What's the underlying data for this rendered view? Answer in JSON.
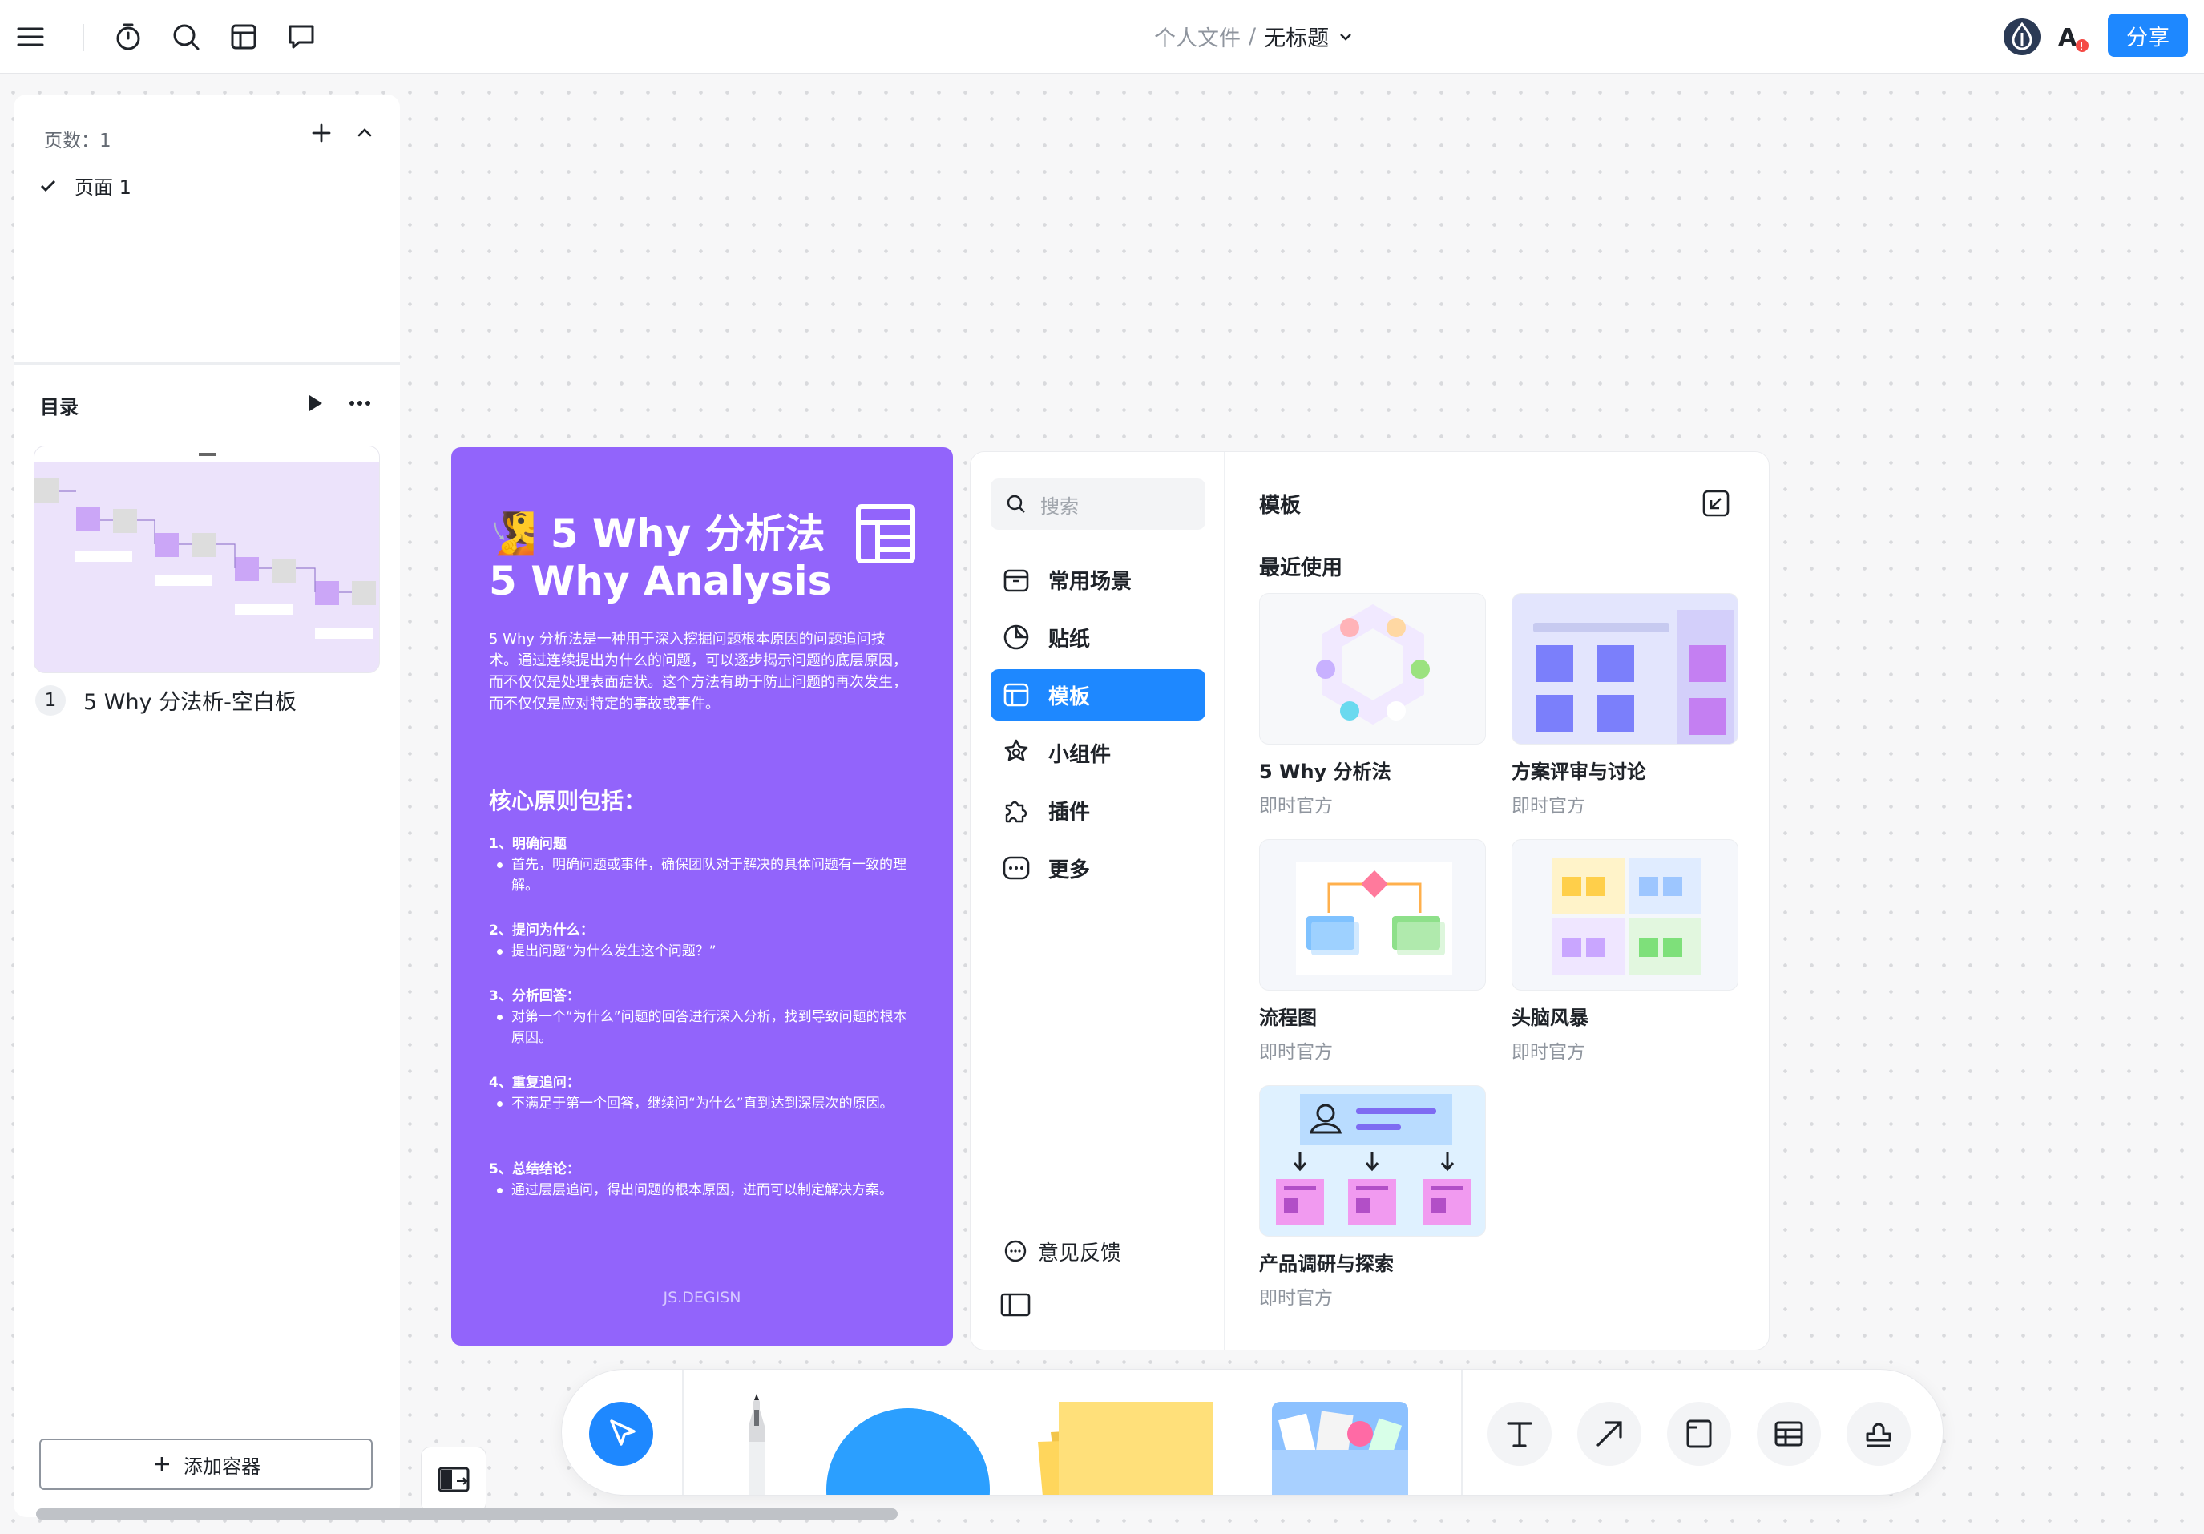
{
  "header": {
    "breadcrumb_root": "个人文件",
    "breadcrumb_sep": "/",
    "doc_title": "无标题",
    "share_label": "分享",
    "icons": [
      "menu-icon",
      "timer-icon",
      "search-icon",
      "template-icon",
      "comment-icon",
      "logo-icon",
      "font-ai-icon"
    ]
  },
  "left_panel": {
    "pages_label": "页数：1",
    "page_item": "页面 1",
    "toc_title": "目录",
    "thumb_number": "1",
    "thumb_name": "5 Why 分法析-空白板",
    "add_container": "添加容器"
  },
  "purple_card": {
    "emoji": "🧏",
    "title_cn": "5 Why 分析法",
    "title_en": "5 Why Analysis",
    "description": "5 Why 分析法是一种用于深入挖掘问题根本原因的问题追问技术。通过连续提出为什么的问题，可以逐步揭示问题的底层原因，而不仅仅是处理表面症状。这个方法有助于防止问题的再次发生，而不仅仅是应对特定的事故或事件。",
    "core_title": "核心原则包括：",
    "items": [
      {
        "h": "1、明确问题",
        "b": "首先，明确问题或事件，确保团队对于解决的具体问题有一致的理解。"
      },
      {
        "h": "2、提问为什么：",
        "b": "提出问题“为什么发生这个问题？”"
      },
      {
        "h": "3、分析回答：",
        "b": "对第一个“为什么”问题的回答进行深入分析，找到导致问题的根本原因。"
      },
      {
        "h": "4、重复追问：",
        "b": "不满足于第一个回答，继续问“为什么”直到达到深层次的原因。"
      },
      {
        "h": "5、总结结论：",
        "b": "通过层层追问，得出问题的根本原因，进而可以制定解决方案。"
      }
    ],
    "footer": "JS.DEGISN"
  },
  "template_panel": {
    "search_placeholder": "搜索",
    "nav": [
      {
        "label": "常用场景",
        "icon": "box-icon"
      },
      {
        "label": "贴纸",
        "icon": "sticker-icon"
      },
      {
        "label": "模板",
        "icon": "template-icon",
        "active": true
      },
      {
        "label": "小组件",
        "icon": "widget-icon"
      },
      {
        "label": "插件",
        "icon": "plugin-icon"
      },
      {
        "label": "更多",
        "icon": "more-icon"
      }
    ],
    "feedback": "意见反馈",
    "title": "模板",
    "recent_label": "最近使用",
    "cards": [
      {
        "name": "5 Why 分析法",
        "sub": "即时官方"
      },
      {
        "name": "方案评审与讨论",
        "sub": "即时官方"
      },
      {
        "name": "流程图",
        "sub": "即时官方"
      },
      {
        "name": "头脑风暴",
        "sub": "即时官方"
      },
      {
        "name": "产品调研与探索",
        "sub": "即时官方"
      }
    ]
  },
  "toolbar": {
    "tools": [
      "select-tool",
      "pen-tool",
      "shape-tool",
      "sticky-note-tool",
      "materials-tool",
      "text-tool",
      "arrow-tool",
      "frame-tool",
      "table-tool",
      "stamp-tool"
    ]
  },
  "colors": {
    "accent": "#1e88ff",
    "purple": "#9264fb"
  }
}
